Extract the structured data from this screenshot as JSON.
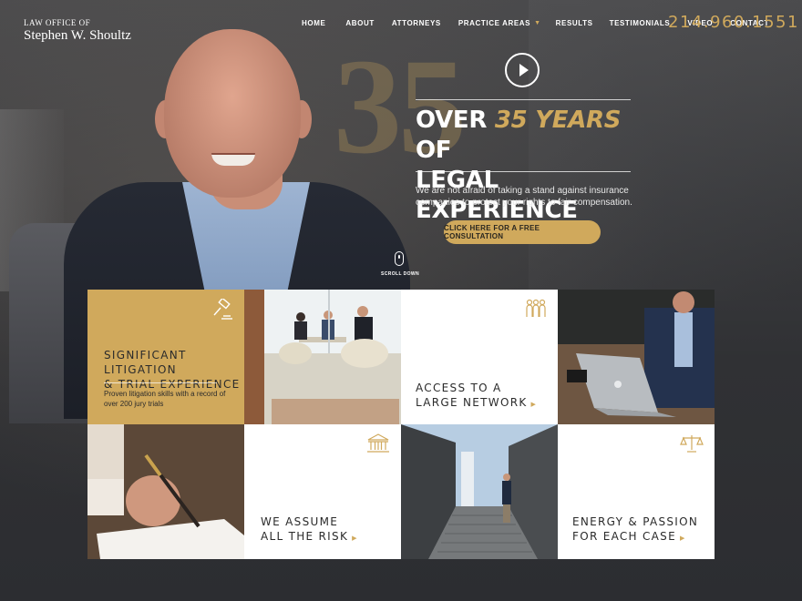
{
  "header": {
    "logo_small": "LAW OFFICE OF",
    "logo_name": "Stephen W. Shoultz",
    "nav": [
      {
        "label": "HOME"
      },
      {
        "label": "ABOUT"
      },
      {
        "label": "ATTORNEYS"
      },
      {
        "label": "PRACTICE AREAS",
        "has_dropdown": true
      },
      {
        "label": "RESULTS"
      },
      {
        "label": "TESTIMONIALS"
      },
      {
        "label": "VIDEO"
      },
      {
        "label": "CONTACT"
      }
    ],
    "phone": "214.960.1551"
  },
  "hero": {
    "bg_number": "35",
    "headline_pre": "OVER",
    "headline_accent": "35 YEARS",
    "headline_post": "OF",
    "headline_line2": "LEGAL EXPERIENCE",
    "subtext": "We are not afraid of taking a stand against insurance companies to protect your rights to fair compensation.",
    "cta": "CLICK HERE FOR A FREE CONSULTATION",
    "scroll_label": "SCROLL DOWN"
  },
  "features": {
    "litigation": {
      "title_line1": "SIGNIFICANT LITIGATION",
      "title_line2": "& TRIAL EXPERIENCE",
      "description": "Proven litigation skills with a record of over 200 jury trials",
      "icon": "gavel-icon"
    },
    "network": {
      "title_line1": "ACCESS TO A",
      "title_line2": "LARGE NETWORK",
      "icon": "people-icon"
    },
    "risk": {
      "title_line1": "WE ASSUME",
      "title_line2": "ALL THE RISK",
      "icon": "courthouse-icon"
    },
    "energy": {
      "title_line1": "ENERGY & PASSION",
      "title_line2": "FOR EACH CASE",
      "icon": "scales-icon"
    }
  },
  "colors": {
    "accent_gold": "#d0a95c",
    "background_dark": "#2c2d31",
    "text_dark": "#2b2b2b"
  }
}
